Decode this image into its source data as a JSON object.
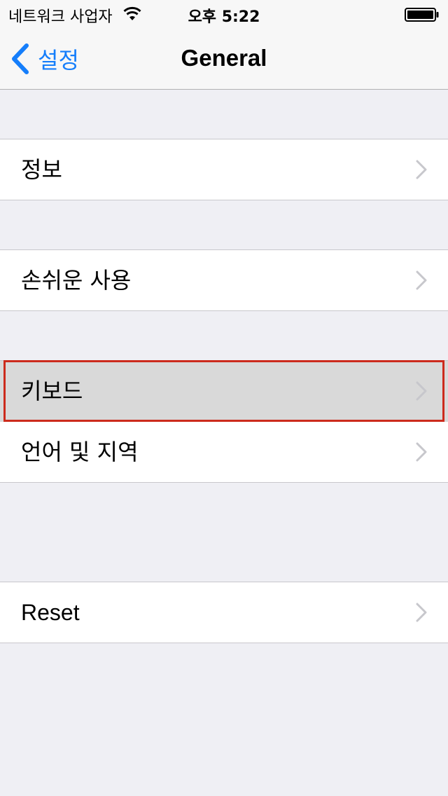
{
  "status_bar": {
    "carrier": "네트워크 사업자",
    "time": "오후 5:22",
    "wifi_icon": "wifi-icon",
    "battery_icon": "battery-full-icon"
  },
  "nav": {
    "back_label": "설정",
    "title": "General"
  },
  "rows": {
    "about": "정보",
    "accessibility": "손쉬운 사용",
    "keyboard": "키보드",
    "language_region": "언어 및 지역",
    "reset": "Reset"
  },
  "colors": {
    "accent": "#157efb",
    "background": "#efeff4",
    "highlight_border": "#cc2b1d",
    "selected_row": "#d9d9d9"
  }
}
